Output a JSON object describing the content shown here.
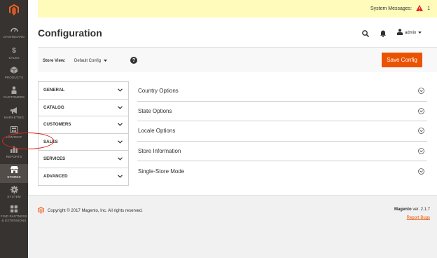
{
  "sidebar": {
    "items": [
      {
        "label": "DASHBOARD",
        "icon": "dashboard-icon"
      },
      {
        "label": "SALES",
        "icon": "dollar-icon"
      },
      {
        "label": "PRODUCTS",
        "icon": "cube-icon"
      },
      {
        "label": "CUSTOMERS",
        "icon": "person-icon"
      },
      {
        "label": "MARKETING",
        "icon": "megaphone-icon"
      },
      {
        "label": "CONTENT",
        "icon": "content-icon"
      },
      {
        "label": "REPORTS",
        "icon": "bar-chart-icon"
      },
      {
        "label": "STORES",
        "icon": "store-icon"
      },
      {
        "label": "SYSTEM",
        "icon": "gear-icon"
      },
      {
        "label": "FIND PARTNERS & EXTENSIONS",
        "icon": "partners-icon"
      }
    ]
  },
  "system_messages": {
    "label": "System Messages:",
    "count": "1"
  },
  "header": {
    "title": "Configuration",
    "user": "admin"
  },
  "store_bar": {
    "label": "Store View:",
    "selected": "Default Config",
    "save_label": "Save Config"
  },
  "tabs": [
    {
      "label": "GENERAL"
    },
    {
      "label": "CATALOG"
    },
    {
      "label": "CUSTOMERS"
    },
    {
      "label": "SALES"
    },
    {
      "label": "SERVICES"
    },
    {
      "label": "ADVANCED"
    }
  ],
  "sections": [
    {
      "label": "Country Options"
    },
    {
      "label": "State Options"
    },
    {
      "label": "Locale Options"
    },
    {
      "label": "Store Information"
    },
    {
      "label": "Single-Store Mode"
    }
  ],
  "footer": {
    "copyright": "Copyright © 2017 Magento, Inc. All rights reserved.",
    "brand": "Magento",
    "version": "ver. 2.1.7",
    "report_bugs": "Report Bugs"
  },
  "colors": {
    "accent": "#eb5202",
    "sidebar": "#373330",
    "highlight": "#d7261e"
  }
}
